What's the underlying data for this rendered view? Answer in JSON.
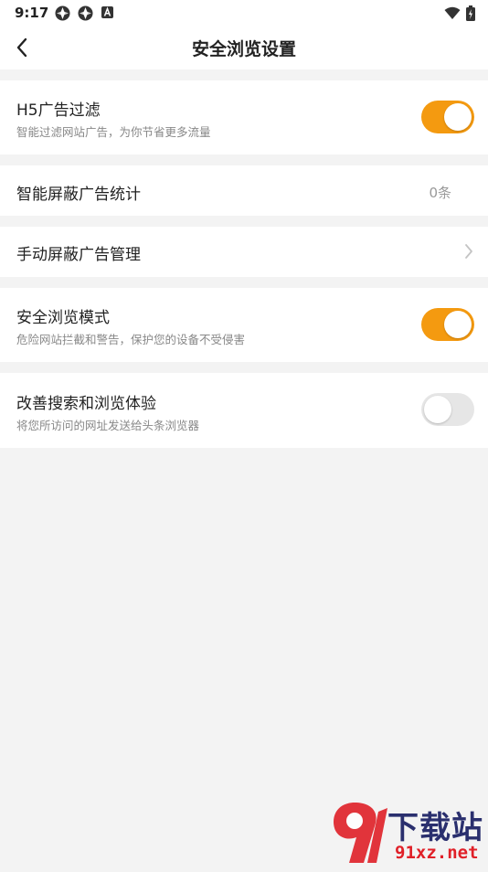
{
  "status_bar": {
    "time": "9:17"
  },
  "header": {
    "title": "安全浏览设置"
  },
  "settings": {
    "h5_filter": {
      "title": "H5广告过滤",
      "subtitle": "智能过滤网站广告，为你节省更多流量",
      "enabled": true
    },
    "smart_block_stats": {
      "title": "智能屏蔽广告统计",
      "value": "0条"
    },
    "manual_block": {
      "title": "手动屏蔽广告管理"
    },
    "safe_mode": {
      "title": "安全浏览模式",
      "subtitle": "危险网站拦截和警告，保护您的设备不受侵害",
      "enabled": true
    },
    "improve": {
      "title": "改善搜索和浏览体验",
      "subtitle": "将您所访问的网址发送给头条浏览器",
      "enabled": false
    }
  },
  "watermark": {
    "cn_text": "下载站",
    "url_text": "91xz.net"
  },
  "colors": {
    "accent": "#f49a10",
    "toggle_off": "#e6e6e6",
    "background": "#f3f3f3",
    "card": "#ffffff"
  }
}
